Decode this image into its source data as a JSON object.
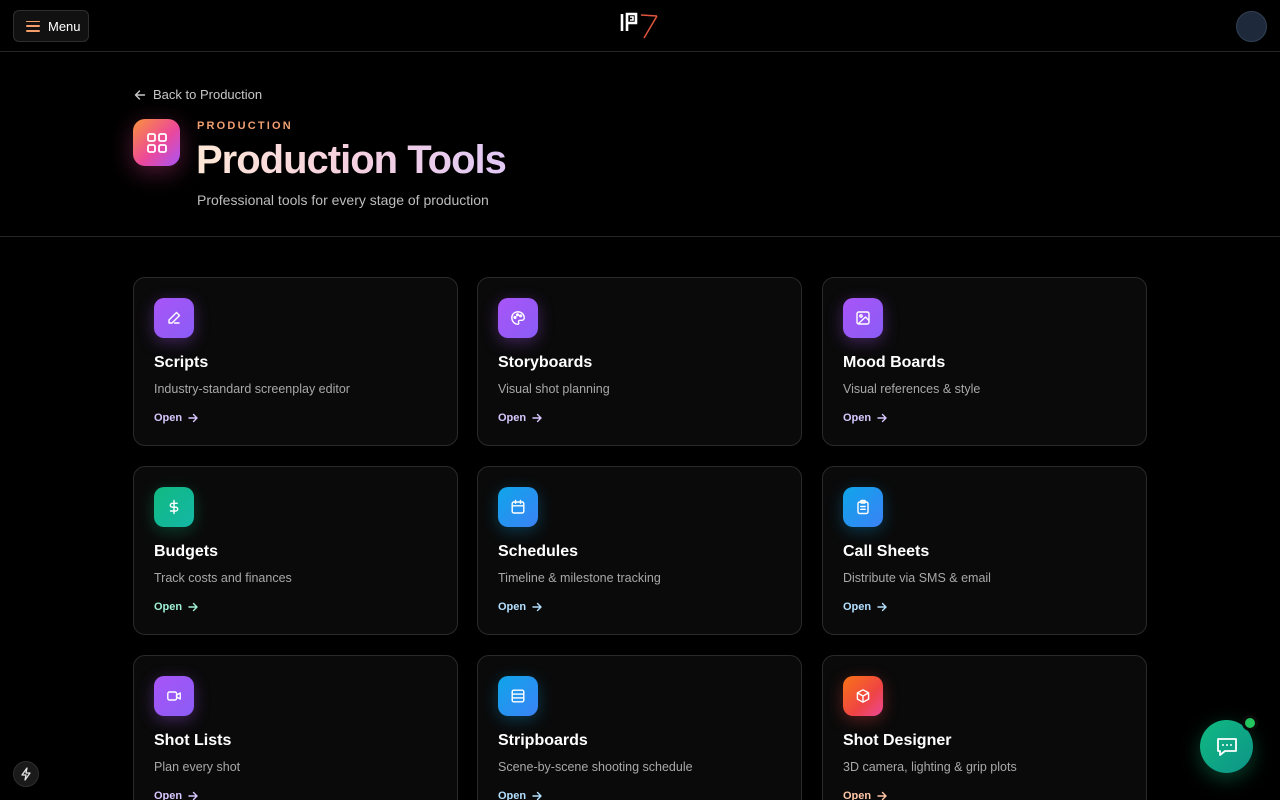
{
  "header": {
    "menu_label": "Menu",
    "logo_text": "IPX"
  },
  "hero": {
    "back_label": "Back to Production",
    "eyebrow": "PRODUCTION",
    "title": "Production Tools",
    "subtitle": "Professional tools for every stage of production"
  },
  "tools": [
    {
      "title": "Scripts",
      "desc": "Industry-standard screenplay editor",
      "open": "Open",
      "icon": "pen-icon",
      "gradient": "purple",
      "link_color": "#d8c8ff"
    },
    {
      "title": "Storyboards",
      "desc": "Visual shot planning",
      "open": "Open",
      "icon": "palette-icon",
      "gradient": "purple",
      "link_color": "#d8c8ff"
    },
    {
      "title": "Mood Boards",
      "desc": "Visual references & style",
      "open": "Open",
      "icon": "image-icon",
      "gradient": "purple",
      "link_color": "#d8c8ff"
    },
    {
      "title": "Budgets",
      "desc": "Track costs and finances",
      "open": "Open",
      "icon": "dollar-icon",
      "gradient": "teal",
      "link_color": "#9ff0d4"
    },
    {
      "title": "Schedules",
      "desc": "Timeline & milestone tracking",
      "open": "Open",
      "icon": "calendar-icon",
      "gradient": "blue",
      "link_color": "#b4e0ff"
    },
    {
      "title": "Call Sheets",
      "desc": "Distribute via SMS & email",
      "open": "Open",
      "icon": "clipboard-icon",
      "gradient": "blue",
      "link_color": "#b4e0ff"
    },
    {
      "title": "Shot Lists",
      "desc": "Plan every shot",
      "open": "Open",
      "icon": "video-icon",
      "gradient": "purple",
      "link_color": "#d8c8ff"
    },
    {
      "title": "Stripboards",
      "desc": "Scene-by-scene shooting schedule",
      "open": "Open",
      "icon": "rows-icon",
      "gradient": "blue",
      "link_color": "#b4e0ff"
    },
    {
      "title": "Shot Designer",
      "desc": "3D camera, lighting & grip plots",
      "open": "Open",
      "icon": "cube-icon",
      "gradient": "orange",
      "link_color": "#ffc8a8"
    }
  ],
  "colors": {
    "accent_orange": "#f59e6b",
    "chat_green": "#10b981",
    "background": "#000000"
  }
}
